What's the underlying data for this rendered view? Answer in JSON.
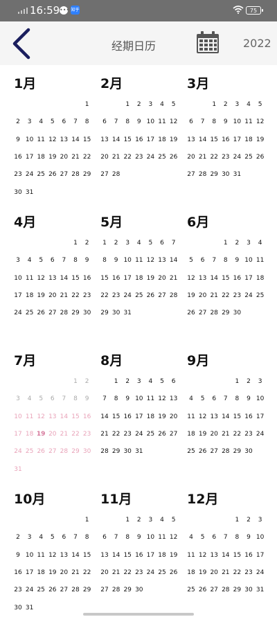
{
  "status_bar": {
    "time": "16:59",
    "notification_icon_label": "知乎",
    "battery": "75"
  },
  "header": {
    "title": "经期日历",
    "year": "2022"
  },
  "months": [
    {
      "label": "1月",
      "days": 31,
      "start": 6
    },
    {
      "label": "2月",
      "days": 28,
      "start": 2
    },
    {
      "label": "3月",
      "days": 31,
      "start": 2
    },
    {
      "label": "4月",
      "days": 30,
      "start": 5
    },
    {
      "label": "5月",
      "days": 31,
      "start": 0
    },
    {
      "label": "6月",
      "days": 30,
      "start": 3
    },
    {
      "label": "7月",
      "days": 31,
      "start": 5
    },
    {
      "label": "8月",
      "days": 31,
      "start": 1
    },
    {
      "label": "9月",
      "days": 30,
      "start": 4
    },
    {
      "label": "10月",
      "days": 31,
      "start": 6
    },
    {
      "label": "11月",
      "days": 30,
      "start": 2
    },
    {
      "label": "12月",
      "days": 31,
      "start": 4
    }
  ],
  "highlight": {
    "month_index": 6,
    "past_days": [
      1,
      2,
      3,
      4,
      5,
      6,
      7,
      8,
      9
    ],
    "pink_days": [
      10,
      11,
      12,
      13,
      14,
      15,
      16,
      17,
      18,
      19,
      20,
      21,
      22,
      23,
      24,
      25,
      26,
      27,
      28,
      29,
      30,
      31
    ],
    "today": 19
  },
  "colors": {
    "accent_navy": "#1b1f5e",
    "pink": "#e9a3b9"
  }
}
